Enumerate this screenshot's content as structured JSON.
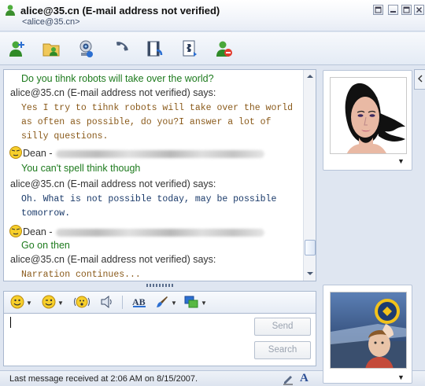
{
  "window": {
    "title": "alice@35.cn (E-mail address not verified)",
    "subtitle": "<alice@35.cn>"
  },
  "toolbar": {
    "buttons": [
      {
        "name": "invite-contact-icon"
      },
      {
        "name": "send-files-icon"
      },
      {
        "name": "webcam-icon"
      },
      {
        "name": "voice-call-icon"
      },
      {
        "name": "video-clip-icon"
      },
      {
        "name": "activities-icon"
      },
      {
        "name": "block-contact-icon"
      }
    ]
  },
  "conversation": [
    {
      "type": "text",
      "text": "Do you tihnk robots will take over the world?",
      "color": "#1d7a1d"
    },
    {
      "type": "header",
      "text": "alice@35.cn (E-mail address not verified) says:"
    },
    {
      "type": "mono",
      "text": "Yes I try to tihnk robots will take over the world"
    },
    {
      "type": "mono",
      "text": "as often as possible, do you?I answer a lot of"
    },
    {
      "type": "mono",
      "text": "silly questions."
    },
    {
      "type": "sender-blurred",
      "text": "Dean -"
    },
    {
      "type": "text",
      "text": "You can't spell think though",
      "color": "#1d7a1d"
    },
    {
      "type": "header",
      "text": "alice@35.cn (E-mail address not verified) says:"
    },
    {
      "type": "mono",
      "text": "Oh. What is not possible today, may be possible"
    },
    {
      "type": "mono",
      "text": "tomorrow."
    },
    {
      "type": "sender-blurred",
      "text": "Dean -"
    },
    {
      "type": "text",
      "text": "Go on then",
      "color": "#1d7a1d"
    },
    {
      "type": "header",
      "text": "alice@35.cn (E-mail address not verified) says:"
    },
    {
      "type": "mono",
      "text": "Narration continues..."
    }
  ],
  "compose": {
    "send_label": "Send",
    "search_label": "Search"
  },
  "status": {
    "text": "Last message received at 2:06 AM on 8/15/2007."
  },
  "colors": {
    "accent": "#1d7a1d",
    "brown_text": "#8a5a1a",
    "navy_text": "#1a3a6a"
  }
}
